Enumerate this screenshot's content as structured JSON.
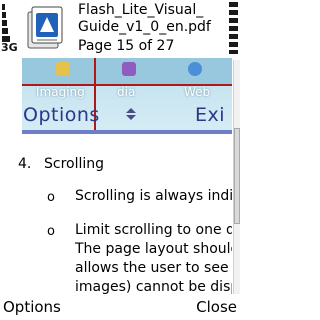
{
  "status": {
    "network": "3G"
  },
  "header": {
    "title": "Flash_Lite_Visual_Guide_v1_0_en.pdf",
    "title_lines": [
      "Flash_Lite_Visual_",
      "Guide_v1_0_en.pdf"
    ],
    "page_indicator": "Page 15 of 27"
  },
  "embedded_page": {
    "labels": [
      "Imaging",
      "dia",
      "Web"
    ],
    "options_label": "Options",
    "exit_label": "Exi"
  },
  "document": {
    "section_number": "4.",
    "section_title": "Scrolling",
    "bullets": [
      {
        "symbol": "o",
        "lines": [
          "Scrolling is always indic"
        ]
      },
      {
        "symbol": "o",
        "lines": [
          "Limit scrolling to one d",
          "The page layout should",
          "allows the user to see a",
          "images) cannot be disp"
        ]
      }
    ]
  },
  "softkeys": {
    "left": "Options",
    "right": "Close"
  },
  "colors": {
    "accent_red": "#b01818",
    "embed_text": "#2a3688"
  }
}
